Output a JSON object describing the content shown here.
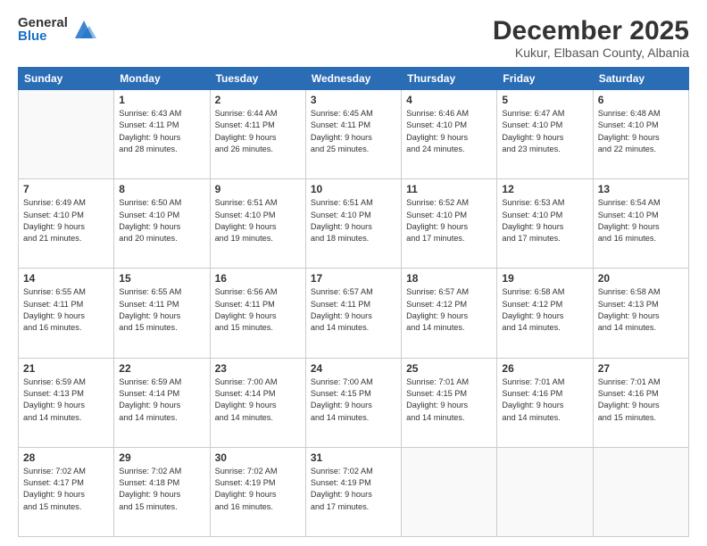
{
  "logo": {
    "general": "General",
    "blue": "Blue"
  },
  "title": "December 2025",
  "location": "Kukur, Elbasan County, Albania",
  "days_header": [
    "Sunday",
    "Monday",
    "Tuesday",
    "Wednesday",
    "Thursday",
    "Friday",
    "Saturday"
  ],
  "weeks": [
    [
      {
        "day": "",
        "info": ""
      },
      {
        "day": "1",
        "info": "Sunrise: 6:43 AM\nSunset: 4:11 PM\nDaylight: 9 hours\nand 28 minutes."
      },
      {
        "day": "2",
        "info": "Sunrise: 6:44 AM\nSunset: 4:11 PM\nDaylight: 9 hours\nand 26 minutes."
      },
      {
        "day": "3",
        "info": "Sunrise: 6:45 AM\nSunset: 4:11 PM\nDaylight: 9 hours\nand 25 minutes."
      },
      {
        "day": "4",
        "info": "Sunrise: 6:46 AM\nSunset: 4:10 PM\nDaylight: 9 hours\nand 24 minutes."
      },
      {
        "day": "5",
        "info": "Sunrise: 6:47 AM\nSunset: 4:10 PM\nDaylight: 9 hours\nand 23 minutes."
      },
      {
        "day": "6",
        "info": "Sunrise: 6:48 AM\nSunset: 4:10 PM\nDaylight: 9 hours\nand 22 minutes."
      }
    ],
    [
      {
        "day": "7",
        "info": "Sunrise: 6:49 AM\nSunset: 4:10 PM\nDaylight: 9 hours\nand 21 minutes."
      },
      {
        "day": "8",
        "info": "Sunrise: 6:50 AM\nSunset: 4:10 PM\nDaylight: 9 hours\nand 20 minutes."
      },
      {
        "day": "9",
        "info": "Sunrise: 6:51 AM\nSunset: 4:10 PM\nDaylight: 9 hours\nand 19 minutes."
      },
      {
        "day": "10",
        "info": "Sunrise: 6:51 AM\nSunset: 4:10 PM\nDaylight: 9 hours\nand 18 minutes."
      },
      {
        "day": "11",
        "info": "Sunrise: 6:52 AM\nSunset: 4:10 PM\nDaylight: 9 hours\nand 17 minutes."
      },
      {
        "day": "12",
        "info": "Sunrise: 6:53 AM\nSunset: 4:10 PM\nDaylight: 9 hours\nand 17 minutes."
      },
      {
        "day": "13",
        "info": "Sunrise: 6:54 AM\nSunset: 4:10 PM\nDaylight: 9 hours\nand 16 minutes."
      }
    ],
    [
      {
        "day": "14",
        "info": "Sunrise: 6:55 AM\nSunset: 4:11 PM\nDaylight: 9 hours\nand 16 minutes."
      },
      {
        "day": "15",
        "info": "Sunrise: 6:55 AM\nSunset: 4:11 PM\nDaylight: 9 hours\nand 15 minutes."
      },
      {
        "day": "16",
        "info": "Sunrise: 6:56 AM\nSunset: 4:11 PM\nDaylight: 9 hours\nand 15 minutes."
      },
      {
        "day": "17",
        "info": "Sunrise: 6:57 AM\nSunset: 4:11 PM\nDaylight: 9 hours\nand 14 minutes."
      },
      {
        "day": "18",
        "info": "Sunrise: 6:57 AM\nSunset: 4:12 PM\nDaylight: 9 hours\nand 14 minutes."
      },
      {
        "day": "19",
        "info": "Sunrise: 6:58 AM\nSunset: 4:12 PM\nDaylight: 9 hours\nand 14 minutes."
      },
      {
        "day": "20",
        "info": "Sunrise: 6:58 AM\nSunset: 4:13 PM\nDaylight: 9 hours\nand 14 minutes."
      }
    ],
    [
      {
        "day": "21",
        "info": "Sunrise: 6:59 AM\nSunset: 4:13 PM\nDaylight: 9 hours\nand 14 minutes."
      },
      {
        "day": "22",
        "info": "Sunrise: 6:59 AM\nSunset: 4:14 PM\nDaylight: 9 hours\nand 14 minutes."
      },
      {
        "day": "23",
        "info": "Sunrise: 7:00 AM\nSunset: 4:14 PM\nDaylight: 9 hours\nand 14 minutes."
      },
      {
        "day": "24",
        "info": "Sunrise: 7:00 AM\nSunset: 4:15 PM\nDaylight: 9 hours\nand 14 minutes."
      },
      {
        "day": "25",
        "info": "Sunrise: 7:01 AM\nSunset: 4:15 PM\nDaylight: 9 hours\nand 14 minutes."
      },
      {
        "day": "26",
        "info": "Sunrise: 7:01 AM\nSunset: 4:16 PM\nDaylight: 9 hours\nand 14 minutes."
      },
      {
        "day": "27",
        "info": "Sunrise: 7:01 AM\nSunset: 4:16 PM\nDaylight: 9 hours\nand 15 minutes."
      }
    ],
    [
      {
        "day": "28",
        "info": "Sunrise: 7:02 AM\nSunset: 4:17 PM\nDaylight: 9 hours\nand 15 minutes."
      },
      {
        "day": "29",
        "info": "Sunrise: 7:02 AM\nSunset: 4:18 PM\nDaylight: 9 hours\nand 15 minutes."
      },
      {
        "day": "30",
        "info": "Sunrise: 7:02 AM\nSunset: 4:19 PM\nDaylight: 9 hours\nand 16 minutes."
      },
      {
        "day": "31",
        "info": "Sunrise: 7:02 AM\nSunset: 4:19 PM\nDaylight: 9 hours\nand 17 minutes."
      },
      {
        "day": "",
        "info": ""
      },
      {
        "day": "",
        "info": ""
      },
      {
        "day": "",
        "info": ""
      }
    ]
  ]
}
